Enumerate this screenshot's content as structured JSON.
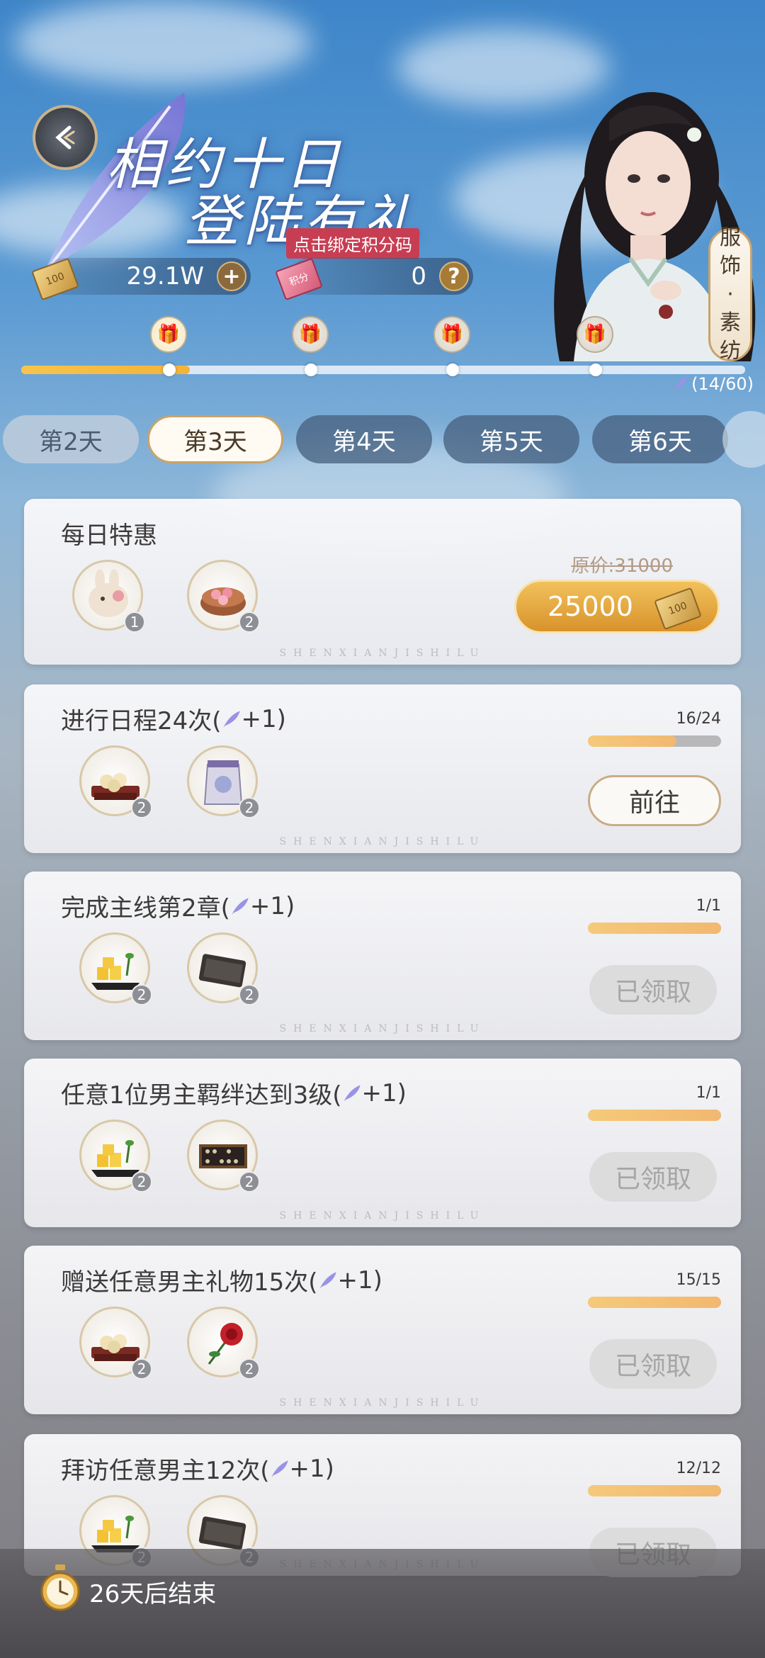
{
  "header": {
    "title_line1": "相约十日",
    "title_line2": "登陆有礼",
    "bind_points_tag": "点击绑定积分码",
    "currency_value": "29.1W",
    "currency_add_glyph": "+",
    "points_value": "0",
    "points_help_glyph": "?",
    "ticket_label": "100",
    "points_ticket_label": "积分",
    "outfit_badge": [
      "服",
      "饰",
      "·",
      "素",
      "纺"
    ]
  },
  "progress": {
    "count_text": "(14/60)",
    "fraction": 0.233
  },
  "tabs": [
    {
      "label": "第2天",
      "state": "prev"
    },
    {
      "label": "第3天",
      "state": "active"
    },
    {
      "label": "第4天",
      "state": "locked"
    },
    {
      "label": "第5天",
      "state": "locked"
    },
    {
      "label": "第6天",
      "state": "locked"
    }
  ],
  "watermark": "SHENXIANJISHILU",
  "daily_deal": {
    "title": "每日特惠",
    "original_price": "原价:31000",
    "price": "25000",
    "items": [
      {
        "icon": "rabbit-icon",
        "qty": "1"
      },
      {
        "icon": "flower-cake-icon",
        "qty": "2"
      }
    ]
  },
  "tasks": [
    {
      "title": "进行日程24次(",
      "reward": "+1)",
      "count": "16/24",
      "progress": 0.667,
      "button": "前往",
      "button_state": "go",
      "items": [
        {
          "icon": "pastry-tray-icon",
          "qty": "2"
        },
        {
          "icon": "bag-icon",
          "qty": "2"
        }
      ]
    },
    {
      "title": "完成主线第2章(",
      "reward": "+1)",
      "count": "1/1",
      "progress": 1.0,
      "button": "已领取",
      "button_state": "done",
      "items": [
        {
          "icon": "gold-cubes-icon",
          "qty": "2"
        },
        {
          "icon": "scroll-icon",
          "qty": "2"
        }
      ]
    },
    {
      "title": "任意1位男主羁绊达到3级(",
      "reward": "+1)",
      "count": "1/1",
      "progress": 1.0,
      "button": "已领取",
      "button_state": "done",
      "items": [
        {
          "icon": "gold-cubes-icon",
          "qty": "2"
        },
        {
          "icon": "abacus-icon",
          "qty": "2"
        }
      ]
    },
    {
      "title": "赠送任意男主礼物15次(",
      "reward": "+1)",
      "count": "15/15",
      "progress": 1.0,
      "button": "已领取",
      "button_state": "done",
      "items": [
        {
          "icon": "pastry-tray-icon",
          "qty": "2"
        },
        {
          "icon": "rose-icon",
          "qty": "2"
        }
      ]
    },
    {
      "title": "拜访任意男主12次(",
      "reward": "+1)",
      "count": "12/12",
      "progress": 1.0,
      "button": "已领取",
      "button_state": "done",
      "items": [
        {
          "icon": "gold-cubes-icon",
          "qty": "2"
        },
        {
          "icon": "scroll-icon",
          "qty": "2"
        }
      ]
    }
  ],
  "footer": {
    "time_left": "26天后结束"
  },
  "colors": {
    "accent_gold": "#d8932b",
    "progress_yellow": "#f3b338",
    "tab_active_border": "#c8a36a",
    "done_button_bg": "#dcdcdc"
  }
}
